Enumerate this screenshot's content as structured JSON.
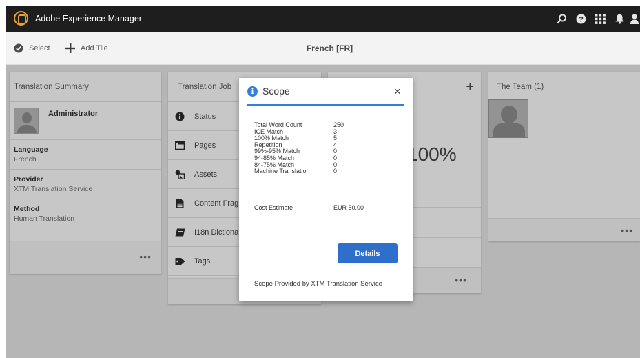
{
  "app": {
    "title": "Adobe Experience Manager"
  },
  "topbar": {
    "icons": [
      "search-icon",
      "help-icon",
      "apps-grid-icon",
      "bell-icon",
      "user-icon"
    ]
  },
  "actionbar": {
    "select_label": "Select",
    "add_tile_label": "Add Tile",
    "page_title": "French [FR]"
  },
  "summary": {
    "title": "Translation Summary",
    "owner": "Administrator",
    "fields": [
      {
        "label": "Language",
        "value": "French"
      },
      {
        "label": "Provider",
        "value": "XTM Translation Service"
      },
      {
        "label": "Method",
        "value": "Human Translation"
      }
    ],
    "more": "•••"
  },
  "job": {
    "title": "Translation Job",
    "rows": [
      {
        "label": "Status",
        "icon": "info-icon"
      },
      {
        "label": "Pages",
        "icon": "pages-icon"
      },
      {
        "label": "Assets",
        "icon": "assets-icon"
      },
      {
        "label": "Content Fragm",
        "icon": "content-fragment-icon"
      },
      {
        "label": "I18n Dictionarie",
        "icon": "dictionary-icon"
      },
      {
        "label": "Tags",
        "icon": "tag-icon"
      }
    ]
  },
  "middle": {
    "add": "+",
    "percent": "100%",
    "more": "•••"
  },
  "team": {
    "title": "The Team (1)",
    "more": "•••"
  },
  "dialog": {
    "title": "Scope",
    "close": "×",
    "stats": [
      {
        "label": "Total Word Count",
        "value": "250"
      },
      {
        "label": "ICE Match",
        "value": "3"
      },
      {
        "label": "100% Match",
        "value": "5"
      },
      {
        "label": "Repetition",
        "value": "4"
      },
      {
        "label": "99%-95% Match",
        "value": "0"
      },
      {
        "label": "94-85% Match",
        "value": "0"
      },
      {
        "label": "84-75% Match",
        "value": "0"
      },
      {
        "label": "Machine Translation",
        "value": "0"
      }
    ],
    "cost_label": "Cost Estimate",
    "cost_value": "EUR 50.00",
    "details_label": "Details",
    "footer": "Scope Provided by XTM Translation Service"
  }
}
